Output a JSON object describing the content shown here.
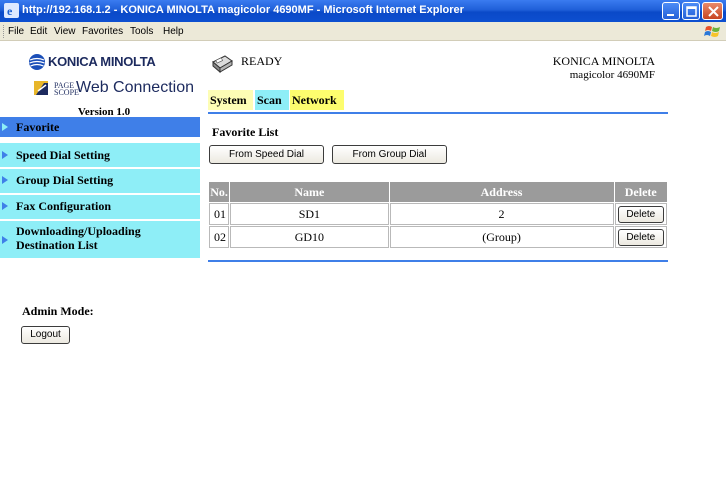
{
  "window": {
    "title": "http://192.168.1.2 - KONICA MINOLTA magicolor 4690MF - Microsoft Internet Explorer"
  },
  "menu": [
    "File",
    "Edit",
    "View",
    "Favorites",
    "Tools",
    "Help"
  ],
  "logos": {
    "brand": "KONICA MINOLTA",
    "pagescope_line1": "PAGE",
    "pagescope_line2": "SCOPE",
    "web_connection": "Web Connection"
  },
  "version": "Version 1.0",
  "nav": [
    {
      "label": "Favorite",
      "active": true
    },
    {
      "label": "Speed Dial Setting",
      "active": false
    },
    {
      "label": "Group Dial Setting",
      "active": false
    },
    {
      "label": "Fax Configuration",
      "active": false
    },
    {
      "label": "Downloading/Uploading Destination List",
      "line1": "Downloading/Uploading",
      "line2": "Destination List",
      "active": false
    }
  ],
  "admin": {
    "label": "Admin Mode:",
    "logout": "Logout"
  },
  "status": "READY",
  "device": {
    "brand": "KONICA MINOLTA",
    "model": "magicolor 4690MF"
  },
  "tabs": [
    "System",
    "Scan",
    "Network"
  ],
  "section_title": "Favorite List",
  "buttons": {
    "speed_dial": "From Speed Dial",
    "group_dial": "From Group Dial"
  },
  "table": {
    "headers": [
      "No.",
      "Name",
      "Address",
      "Delete"
    ],
    "rows": [
      {
        "no": "01",
        "name": "SD1",
        "address": "2",
        "action": "Delete"
      },
      {
        "no": "02",
        "name": "GD10",
        "address": "(Group)",
        "action": "Delete"
      }
    ]
  },
  "colors": {
    "nav_bg": "#8eeef7",
    "nav_active": "#3f7fe8",
    "rule": "#3f7fe8",
    "header_bg": "#9b9b9b"
  }
}
